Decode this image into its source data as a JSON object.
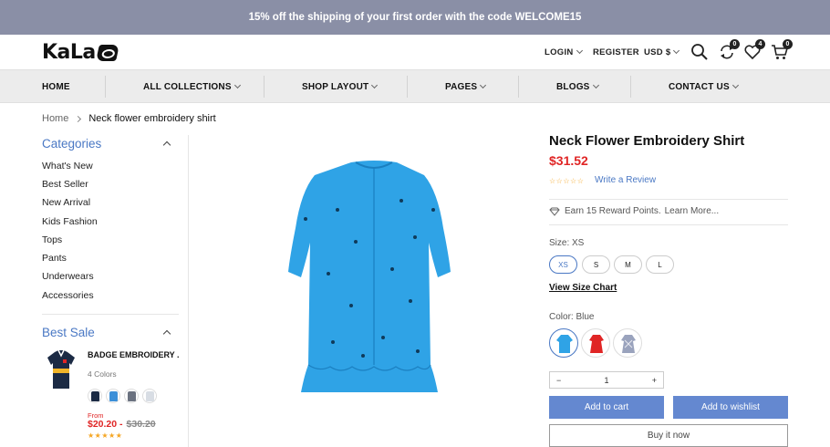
{
  "promo": {
    "text": "15% off the shipping of your first order with the code WELCOME15"
  },
  "header": {
    "logo": "KaLa",
    "login": "LOGIN",
    "register": "REGISTER",
    "currency": "USD $",
    "compare_count": "0",
    "wishlist_count": "4",
    "cart_count": "0"
  },
  "nav": {
    "items": [
      {
        "label": "HOME"
      },
      {
        "label": "ALL COLLECTIONS"
      },
      {
        "label": "SHOP LAYOUT"
      },
      {
        "label": "PAGES"
      },
      {
        "label": "BLOGS"
      },
      {
        "label": "CONTACT US"
      }
    ]
  },
  "breadcrumb": {
    "home": "Home",
    "current": "Neck flower embroidery shirt"
  },
  "sidebar": {
    "categories_title": "Categories",
    "categories": [
      {
        "label": "What's New"
      },
      {
        "label": "Best Seller"
      },
      {
        "label": "New Arrival"
      },
      {
        "label": "Kids Fashion"
      },
      {
        "label": "Tops"
      },
      {
        "label": "Pants"
      },
      {
        "label": "Underwears"
      },
      {
        "label": "Accessories"
      }
    ],
    "best_sale_title": "Best Sale",
    "best_sale": {
      "title": "BADGE EMBROIDERY ...",
      "colors": "4 Colors",
      "from": "From",
      "price": "$20.20 -",
      "old_price": "$30.20",
      "stars": "★★★★★",
      "swatch_colors": [
        "#1b2a44",
        "#3b8fd8",
        "#6b7280",
        "#d8dde4"
      ]
    }
  },
  "product": {
    "title": "Neck Flower Embroidery Shirt",
    "price": "$31.52",
    "stars": "☆☆☆☆☆",
    "review_link": "Write a Review",
    "reward": "Earn 15 Reward Points.",
    "learn_more": "Learn More...",
    "size_label": "Size: XS",
    "sizes": [
      {
        "label": "XS"
      },
      {
        "label": "S"
      },
      {
        "label": "M"
      },
      {
        "label": "L"
      }
    ],
    "size_chart": "View Size Chart",
    "color_label": "Color: Blue",
    "colors": [
      "#2fa3e6",
      "#e02525",
      "#9aa3bd"
    ],
    "qty_minus": "−",
    "qty_value": "1",
    "qty_plus": "+",
    "add_to_cart": "Add to cart",
    "add_to_wishlist": "Add to wishlist",
    "buy_now": "Buy it now"
  },
  "theme": {
    "accent": "#4a78c4",
    "button": "#6488d0",
    "price": "#e02525",
    "promo_bg": "#8a8fa6"
  }
}
